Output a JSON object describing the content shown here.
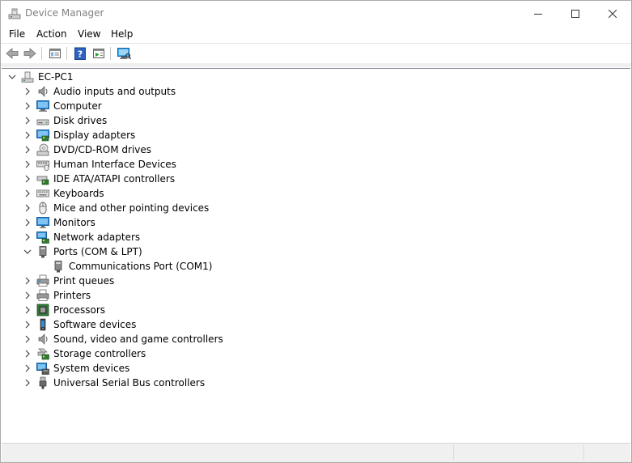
{
  "window": {
    "title": "Device Manager"
  },
  "menu": {
    "file": "File",
    "action": "Action",
    "view": "View",
    "help": "Help"
  },
  "toolbar": {
    "buttons": [
      "back-icon",
      "forward-icon",
      "properties-icon",
      "help-icon",
      "update-driver-icon",
      "scan-hardware-icon"
    ]
  },
  "tree": {
    "root": "EC-PC1",
    "categories": [
      {
        "label": "Audio inputs and outputs",
        "icon": "speaker-icon",
        "expanded": false
      },
      {
        "label": "Computer",
        "icon": "computer-icon",
        "expanded": false
      },
      {
        "label": "Disk drives",
        "icon": "disk-drive-icon",
        "expanded": false
      },
      {
        "label": "Display adapters",
        "icon": "display-adapter-icon",
        "expanded": false
      },
      {
        "label": "DVD/CD-ROM drives",
        "icon": "dvd-drive-icon",
        "expanded": false
      },
      {
        "label": "Human Interface Devices",
        "icon": "hid-icon",
        "expanded": false
      },
      {
        "label": "IDE ATA/ATAPI controllers",
        "icon": "ide-controller-icon",
        "expanded": false
      },
      {
        "label": "Keyboards",
        "icon": "keyboard-icon",
        "expanded": false
      },
      {
        "label": "Mice and other pointing devices",
        "icon": "mouse-icon",
        "expanded": false
      },
      {
        "label": "Monitors",
        "icon": "monitor-icon",
        "expanded": false
      },
      {
        "label": "Network adapters",
        "icon": "network-adapter-icon",
        "expanded": false
      },
      {
        "label": "Ports (COM & LPT)",
        "icon": "port-icon",
        "expanded": true,
        "children": [
          {
            "label": "Communications Port (COM1)",
            "icon": "port-icon"
          }
        ]
      },
      {
        "label": "Print queues",
        "icon": "print-queue-icon",
        "expanded": false
      },
      {
        "label": "Printers",
        "icon": "printer-icon",
        "expanded": false
      },
      {
        "label": "Processors",
        "icon": "processor-icon",
        "expanded": false
      },
      {
        "label": "Software devices",
        "icon": "software-device-icon",
        "expanded": false
      },
      {
        "label": "Sound, video and game controllers",
        "icon": "sound-icon",
        "expanded": false
      },
      {
        "label": "Storage controllers",
        "icon": "storage-controller-icon",
        "expanded": false
      },
      {
        "label": "System devices",
        "icon": "system-device-icon",
        "expanded": false
      },
      {
        "label": "Universal Serial Bus controllers",
        "icon": "usb-icon",
        "expanded": false
      }
    ]
  },
  "colors": {
    "accent": "#1e7ad6",
    "text": "#000000",
    "title_inactive": "#808080"
  }
}
